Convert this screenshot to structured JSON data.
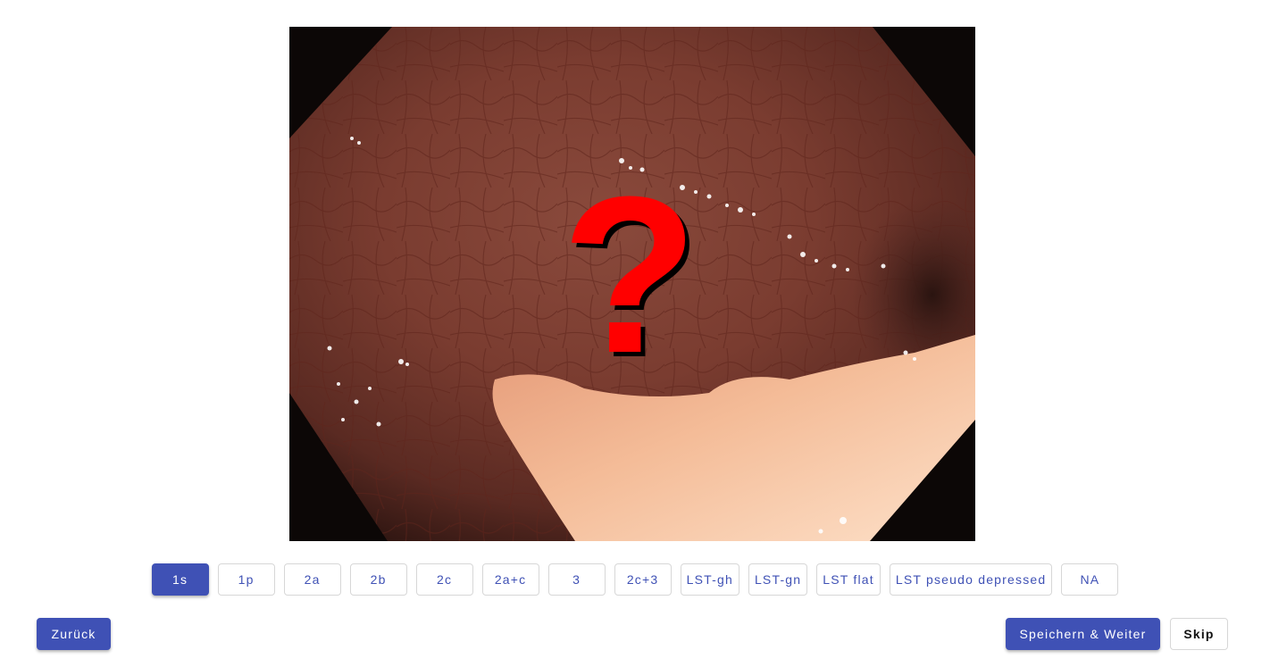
{
  "image": {
    "overlay_icon": "question-mark-icon",
    "overlay_color": "#ff0000"
  },
  "classification": {
    "selected": "1s",
    "accent_color": "#3f51b5",
    "options": [
      {
        "label": "1s"
      },
      {
        "label": "1p"
      },
      {
        "label": "2a"
      },
      {
        "label": "2b"
      },
      {
        "label": "2c"
      },
      {
        "label": "2a+c"
      },
      {
        "label": "3"
      },
      {
        "label": "2c+3"
      },
      {
        "label": "LST-gh"
      },
      {
        "label": "LST-gn"
      },
      {
        "label": "LST flat"
      },
      {
        "label": "LST pseudo depressed"
      },
      {
        "label": "NA"
      }
    ]
  },
  "navigation": {
    "back_label": "Zurück",
    "save_next_label": "Speichern & Weiter",
    "skip_label": "Skip"
  }
}
